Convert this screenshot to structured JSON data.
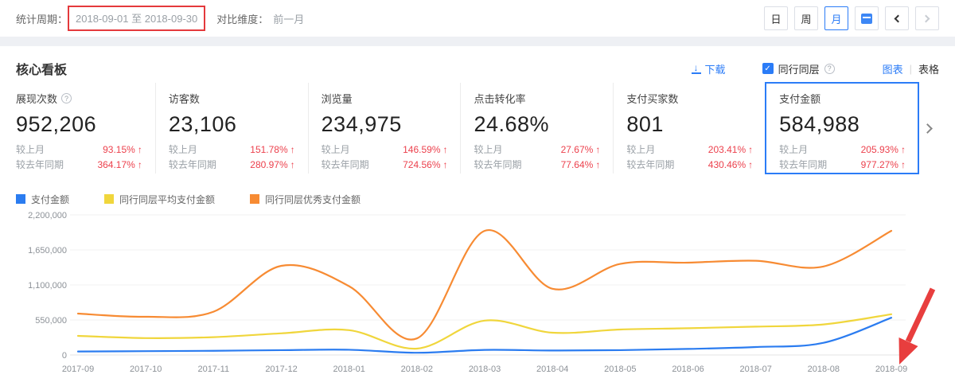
{
  "topbar": {
    "period_label": "统计周期：",
    "period_value": "2018-09-01 至 2018-09-30",
    "compare_label": "对比维度：",
    "compare_value": "前一月",
    "range_buttons": [
      "日",
      "周",
      "月"
    ],
    "active_range": "月"
  },
  "panel": {
    "title": "核心看板",
    "download_label": "下载",
    "peer_checkbox_label": "同行同层",
    "view_chart_label": "图表",
    "view_table_label": "表格"
  },
  "metrics": {
    "row_labels": {
      "mom": "较上月",
      "yoy": "较去年同期"
    },
    "cards": [
      {
        "title": "展现次数",
        "value": "952,206",
        "mom_pct": "93.15%",
        "yoy_pct": "364.17%"
      },
      {
        "title": "访客数",
        "value": "23,106",
        "mom_pct": "151.78%",
        "yoy_pct": "280.97%"
      },
      {
        "title": "浏览量",
        "value": "234,975",
        "mom_pct": "146.59%",
        "yoy_pct": "724.56%"
      },
      {
        "title": "点击转化率",
        "value": "24.68%",
        "mom_pct": "27.67%",
        "yoy_pct": "77.64%"
      },
      {
        "title": "支付买家数",
        "value": "801",
        "mom_pct": "203.41%",
        "yoy_pct": "430.46%"
      },
      {
        "title": "支付金额",
        "value": "584,988",
        "mom_pct": "205.93%",
        "yoy_pct": "977.27%"
      }
    ]
  },
  "chart_data": {
    "type": "line",
    "title": "",
    "xlabel": "",
    "ylabel": "",
    "grid": true,
    "legend_position": "top",
    "ylim": [
      0,
      2200000
    ],
    "yticks": [
      0,
      550000,
      1100000,
      1650000,
      2200000
    ],
    "categories": [
      "2017-09",
      "2017-10",
      "2017-11",
      "2017-12",
      "2018-01",
      "2018-02",
      "2018-03",
      "2018-04",
      "2018-05",
      "2018-06",
      "2018-07",
      "2018-08",
      "2018-09"
    ],
    "series": [
      {
        "name": "支付金额",
        "color": "#2b7cf0",
        "values": [
          54303,
          60000,
          66000,
          76000,
          82000,
          35000,
          80000,
          70000,
          76000,
          95000,
          125000,
          191216,
          584988
        ]
      },
      {
        "name": "同行同层平均支付金额",
        "color": "#f0d63c",
        "values": [
          300000,
          265000,
          280000,
          340000,
          390000,
          100000,
          540000,
          350000,
          400000,
          420000,
          445000,
          480000,
          640000
        ]
      },
      {
        "name": "同行同层优秀支付金额",
        "color": "#f78b33",
        "values": [
          650000,
          600000,
          680000,
          1400000,
          1080000,
          260000,
          1950000,
          1040000,
          1430000,
          1450000,
          1480000,
          1390000,
          1950000
        ]
      }
    ]
  },
  "icons": {
    "download": "↓",
    "check": "✓",
    "help": "?",
    "up": "↑"
  },
  "colors": {
    "accent_blue": "#2b7cf7",
    "up_red": "#ec414d",
    "annotation_box_red": "#e4393c",
    "annotation_arrow_red": "#e83e3e",
    "line_blue": "#2b7cf0",
    "line_yellow": "#f0d63c",
    "line_orange": "#f78b33"
  }
}
